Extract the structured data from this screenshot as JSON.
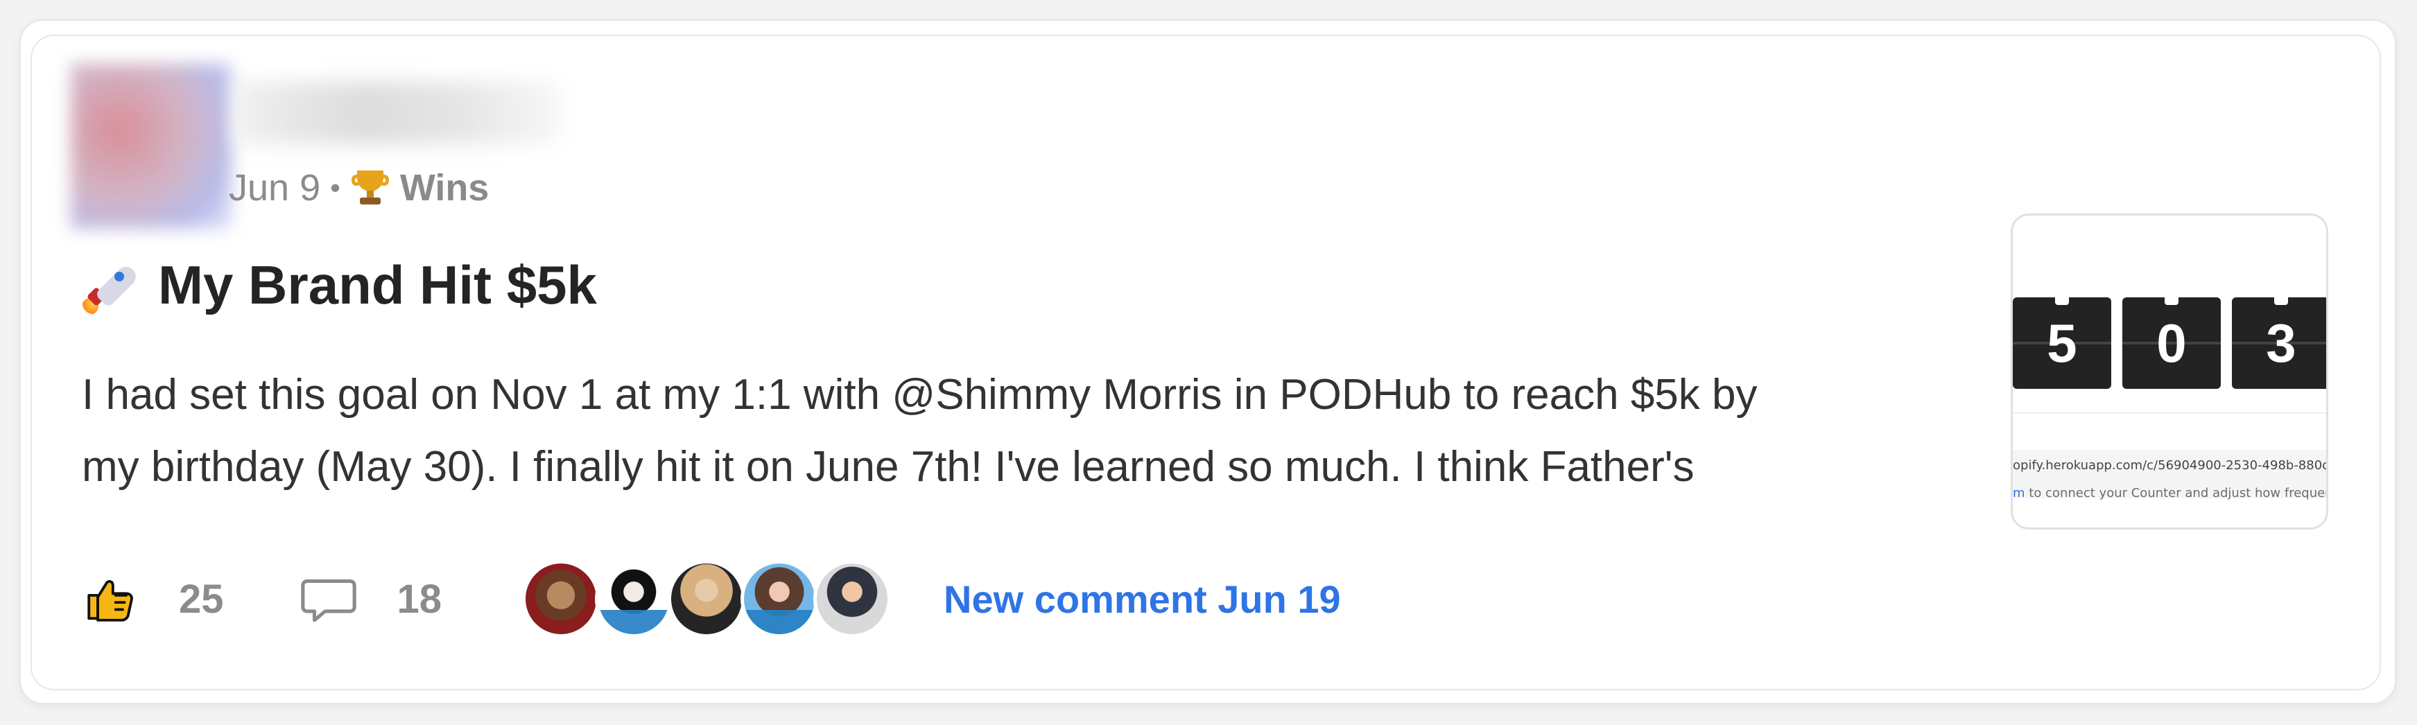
{
  "post": {
    "date": "Jun 9",
    "separator": "•",
    "category": "Wins",
    "title": "My Brand Hit $5k",
    "body_line_1": "I had set this goal on Nov 1 at my 1:1 with @Shimmy Morris in PODHub to reach $5k by",
    "body_line_2": "my birthday (May 30). I finally hit it on June 7th! I've learned so much. I think Father's",
    "likes_count": "25",
    "comments_count": "18",
    "new_comment_text": "New comment Jun 19",
    "icon_names": {
      "trophy": "trophy-icon",
      "rocket": "rocket-icon",
      "like": "thumb-up-icon",
      "comment": "comment-icon"
    }
  },
  "preview": {
    "digits": [
      "5",
      "0",
      "3"
    ],
    "url_text": "opify.herokuapp.com/c/56904900-2530-498b-880c",
    "note_link": "m",
    "note_text": " to connect your Counter and adjust how frequently"
  },
  "colors": {
    "accent": "#2f74e6",
    "text": "#242424",
    "muted": "#8b8b8b",
    "border": "#e7e7e7"
  }
}
